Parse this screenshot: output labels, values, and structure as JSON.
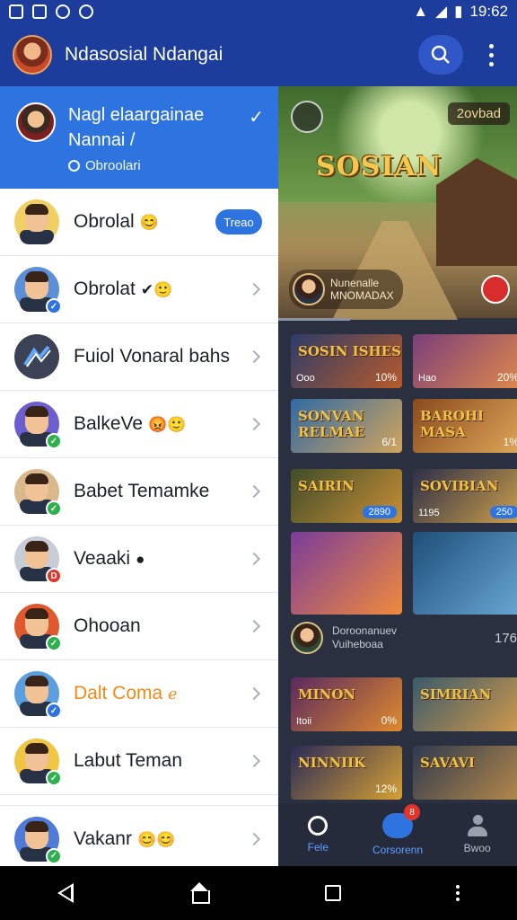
{
  "status_bar": {
    "time": "19:62"
  },
  "app_bar": {
    "title": "Ndasosial Ndangai"
  },
  "drawer": {
    "header": {
      "line1": "Nagl elaargainae",
      "line2": "Nannai  /",
      "status": "Obroolari"
    },
    "items": [
      {
        "label": "Obrolal",
        "emoji": "😊",
        "pill": "Treao",
        "badge": ""
      },
      {
        "label": "Obrolat",
        "emoji": "✔🙂",
        "pill": "",
        "badge": "verified"
      },
      {
        "label": "Fuiol Vonaral bahs",
        "emoji": "",
        "pill": "",
        "badge": ""
      },
      {
        "label": "BalkeVe",
        "emoji": "😡🙂",
        "pill": "",
        "badge": "online"
      },
      {
        "label": "Babet Temamke",
        "emoji": "",
        "pill": "",
        "badge": "online"
      },
      {
        "label": "Veaaki",
        "emoji": "●",
        "pill": "",
        "badge": "D"
      },
      {
        "label": "Ohooan",
        "emoji": "",
        "pill": "",
        "badge": "online"
      },
      {
        "label": "Dalt Coma",
        "emoji": "ℯ",
        "pill": "",
        "badge": "verified"
      },
      {
        "label": "Labut Teman",
        "emoji": "",
        "pill": "",
        "badge": "online"
      },
      {
        "label": "Vakanr",
        "emoji": "😊😊",
        "pill": "",
        "badge": "online"
      }
    ]
  },
  "hero": {
    "title": "SOSIAN",
    "tag": "2ovbad",
    "host_line1": "Nunenalle",
    "host_line2": "MNOMADAX"
  },
  "tiles": [
    {
      "art": "SOSIN ISHES",
      "label": "Ooo",
      "value": "10%",
      "chip": "",
      "colors": [
        "#2d3c6a",
        "#b75a2a"
      ]
    },
    {
      "art": "",
      "label": "Hao",
      "value": "20%",
      "chip": "",
      "colors": [
        "#7b3f7a",
        "#e0894a"
      ]
    },
    {
      "art": "SONVAN RELMAE",
      "label": "",
      "value": "6/1",
      "chip": "",
      "colors": [
        "#2f6aa3",
        "#d3a45c"
      ]
    },
    {
      "art": "BAROHI MASA",
      "label": "",
      "value": "1%",
      "chip": "",
      "colors": [
        "#8a4a1d",
        "#e0a85a"
      ]
    },
    {
      "art": "SAIRIN",
      "label": "",
      "value": "",
      "chip": "2890",
      "colors": [
        "#3f4d2a",
        "#c98f35"
      ]
    },
    {
      "art": "SOVIBIAN",
      "label": "1195",
      "value": "",
      "chip": "250",
      "colors": [
        "#2c2f48",
        "#d1a24a"
      ]
    },
    {
      "art": "",
      "label": "",
      "value": "",
      "chip": "",
      "colors": [
        "#7a3c9a",
        "#f08a3c"
      ]
    },
    {
      "art": "",
      "label": "",
      "value": "",
      "chip": "",
      "colors": [
        "#1d4f7a",
        "#6aa7d4"
      ]
    }
  ],
  "streamer": {
    "line1": "Doroonanuev",
    "line2": "Vuiheboaa",
    "value": "176"
  },
  "tiles2": [
    {
      "art": "MINON",
      "label": "Itoii",
      "value": "0%",
      "chip": "",
      "colors": [
        "#5a2a5e",
        "#e08a2c"
      ]
    },
    {
      "art": "SIMRIAN",
      "label": "",
      "value": "",
      "chip": "",
      "colors": [
        "#3a5a6a",
        "#d49a4a"
      ]
    },
    {
      "art": "NINNIIK",
      "label": "",
      "value": "12%",
      "chip": "",
      "colors": [
        "#2a2a58",
        "#d6a033"
      ]
    },
    {
      "art": "SAVAVI",
      "label": "",
      "value": "",
      "chip": "",
      "colors": [
        "#2e3a4e",
        "#b88a4a"
      ]
    }
  ],
  "tabs": [
    {
      "label": "Fele",
      "active": true
    },
    {
      "label": "Corsorenn",
      "badge": "8",
      "active": true
    },
    {
      "label": "Bwoo",
      "active": false
    }
  ]
}
